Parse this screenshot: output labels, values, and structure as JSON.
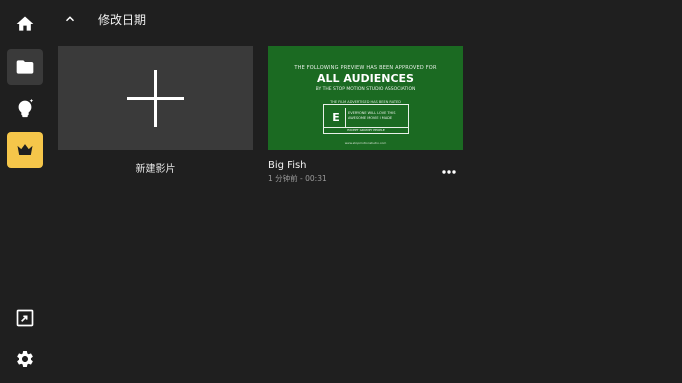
{
  "header": {
    "sort_label": "修改日期"
  },
  "cards": {
    "new": {
      "label": "新建影片"
    },
    "film": {
      "title": "Big Fish",
      "subtitle": "1 分钟前 - 00:31",
      "thumbnail": {
        "line1": "THE FOLLOWING PREVIEW HAS BEEN APPROVED FOR",
        "line2": "ALL AUDIENCES",
        "line3": "BY THE STOP MOTION STUDIO ASSOCIATION",
        "line4": "THE FILM ADVERTISED HAS BEEN RATED",
        "rating": "E",
        "rating_desc": "EVERYONE WILL LOVE THIS AWESOME MOVIE I MADE",
        "rating_bar": "EXCEPT GRUMPY PEOPLE",
        "footer": "www.stopmotionstudio.com"
      }
    }
  },
  "colors": {
    "accent": "#f5c64a",
    "background": "#1f1f1f",
    "thumb_green": "#1b6a22"
  }
}
